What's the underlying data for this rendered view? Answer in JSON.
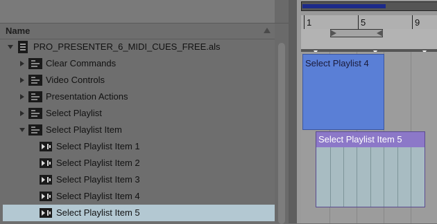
{
  "browser": {
    "header_label": "Name",
    "items": [
      {
        "label": "PRO_PRESENTER_6_MIDI_CUES_FREE.als",
        "kind": "file",
        "expanded": true
      },
      {
        "label": "Clear Commands",
        "kind": "track",
        "expanded": false
      },
      {
        "label": "Video Controls",
        "kind": "track",
        "expanded": false
      },
      {
        "label": "Presentation Actions",
        "kind": "track",
        "expanded": false
      },
      {
        "label": "Select Playlist",
        "kind": "track",
        "expanded": false
      },
      {
        "label": "Select Playlist Item",
        "kind": "track",
        "expanded": true
      },
      {
        "label": "Select Playlist Item 1",
        "kind": "clip"
      },
      {
        "label": "Select Playlist Item 2",
        "kind": "clip"
      },
      {
        "label": "Select Playlist Item 3",
        "kind": "clip"
      },
      {
        "label": "Select Playlist Item 4",
        "kind": "clip"
      },
      {
        "label": "Select Playlist Item 5",
        "kind": "clip",
        "selected": true
      }
    ]
  },
  "arrangement": {
    "ruler_numbers": [
      "1",
      "5",
      "9"
    ],
    "clips": [
      {
        "label": "Select Playlist 4",
        "color": "#5a7fd6"
      },
      {
        "label": "Select Playlist Item 5",
        "color": "#8c78c8"
      }
    ]
  }
}
